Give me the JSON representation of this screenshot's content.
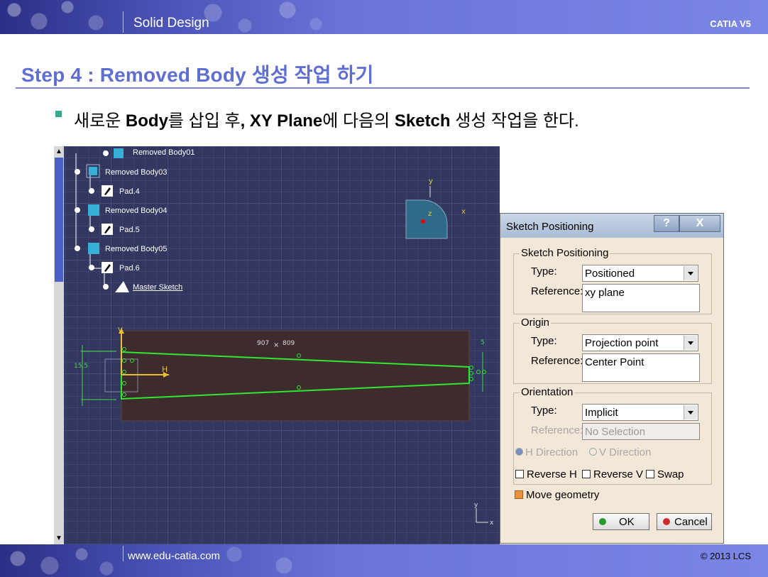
{
  "header": {
    "title": "Solid Design",
    "brand": "CATIA V5"
  },
  "heading": "Step 4 : Removed Body 생성 작업 하기",
  "bullet": {
    "p1": "새로운 ",
    "b1": "Body",
    "p2": "를 삽입 후",
    "b2": ", XY Plane",
    "p3": "에 다음의 ",
    "b3": "Sketch",
    "p4": " 생성 작업을 한다."
  },
  "tree": {
    "items": [
      {
        "label": "Removed Body01"
      },
      {
        "label": "Removed Body03"
      },
      {
        "label": "Pad.4"
      },
      {
        "label": "Removed Body04"
      },
      {
        "label": "Pad.5"
      },
      {
        "label": "Removed Body05"
      },
      {
        "label": "Pad.6"
      },
      {
        "label": "Master Sketch"
      }
    ]
  },
  "viewer": {
    "axis_labels": {
      "y": "y",
      "x": "x",
      "z": "z"
    },
    "sketch_h": "H",
    "sketch_v": "V",
    "dim_left": "15.5",
    "dim_right": "5",
    "coord_x": "907",
    "coord_sep": "×",
    "coord_y": "809",
    "mini_axis_y": "y",
    "mini_axis_x": "x"
  },
  "dialog": {
    "title": "Sketch Positioning",
    "help": "?",
    "close": "X",
    "group1": {
      "label": "Sketch Positioning",
      "type_label": "Type:",
      "type_value": "Positioned",
      "ref_label": "Reference:",
      "ref_value": "xy plane"
    },
    "group2": {
      "label": "Origin",
      "type_label": "Type:",
      "type_value": "Projection point",
      "ref_label": "Reference:",
      "ref_value": "Center Point"
    },
    "group3": {
      "label": "Orientation",
      "type_label": "Type:",
      "type_value": "Implicit",
      "ref_label": "Reference:",
      "ref_value": "No Selection",
      "h_direction": "H Direction",
      "v_direction": "V Direction",
      "reverse_h": "Reverse H",
      "reverse_v": "Reverse V",
      "swap": "Swap"
    },
    "move_geometry": "Move geometry",
    "ok": "OK",
    "cancel": "Cancel"
  },
  "colors": {
    "accent": "#5f6ed2",
    "sketch": "#2ee82e",
    "viewport": "#33365e"
  },
  "footer": {
    "url": "www.edu-catia.com",
    "copyright": "© 2013 LCS"
  }
}
